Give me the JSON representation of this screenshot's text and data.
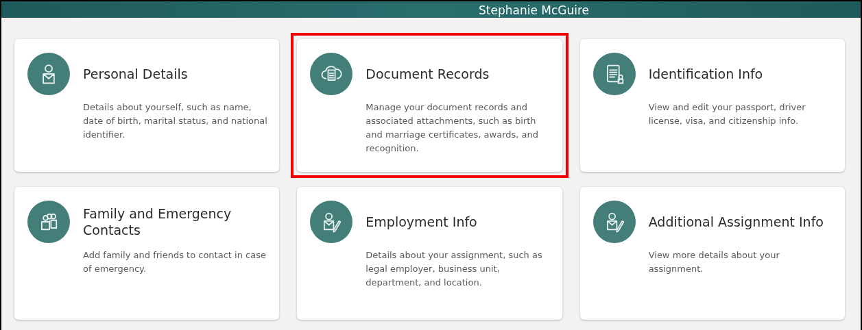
{
  "banner": {
    "user_name": "Stephanie McGuire"
  },
  "cards": [
    {
      "title": "Personal Details",
      "description": "Details about yourself, such as name, date of birth, marital status, and national identifier.",
      "highlighted": false
    },
    {
      "title": "Document Records",
      "description": "Manage your document records and associated attachments, such as birth and marriage certificates, awards, and recognition.",
      "highlighted": true
    },
    {
      "title": "Identification Info",
      "description": "View and edit your passport, driver license, visa, and citizenship info.",
      "highlighted": false
    },
    {
      "title": "Family and Emergency Contacts",
      "description": "Add family and friends to contact in case of emergency.",
      "highlighted": false
    },
    {
      "title": "Employment Info",
      "description": "Details about your assignment, such as legal employer, business unit, department, and location.",
      "highlighted": false
    },
    {
      "title": "Additional Assignment Info",
      "description": "View more details about your assignment.",
      "highlighted": false
    }
  ]
}
